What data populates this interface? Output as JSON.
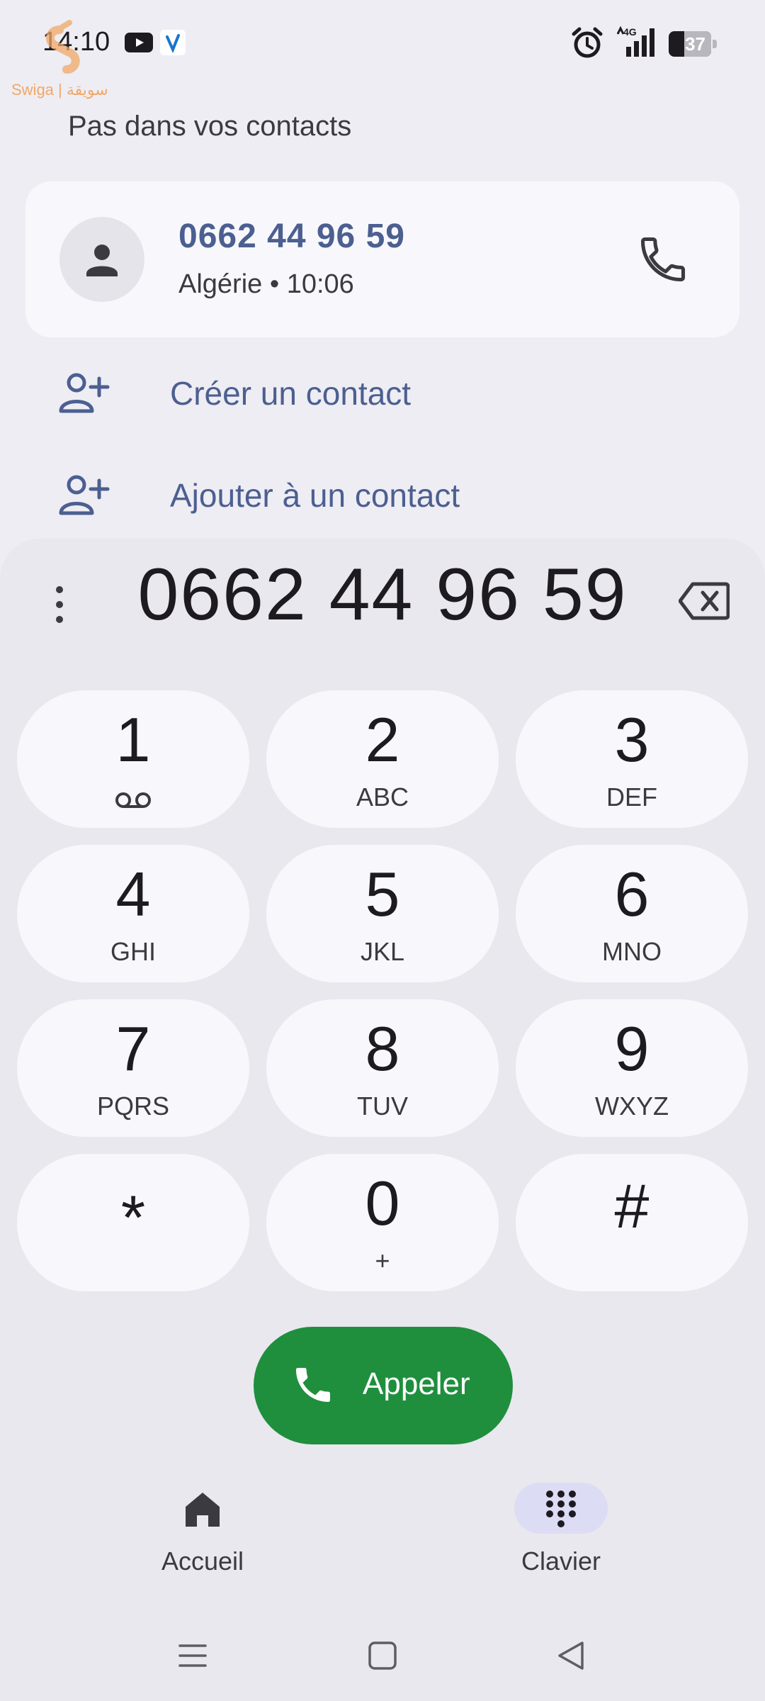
{
  "status_bar": {
    "time": "14:10",
    "network": "4G",
    "battery": "37",
    "battery_fraction": 0.37,
    "icons": [
      "youtube-icon",
      "vpn-icon",
      "alarm-icon",
      "signal-icon",
      "battery-icon"
    ]
  },
  "watermark": {
    "text": "Swiga | سويقة"
  },
  "section_label": "Pas dans vos contacts",
  "contact_card": {
    "number": "0662 44 96 59",
    "meta": "Algérie • 10:06"
  },
  "actions": [
    {
      "label": "Créer un contact",
      "icon": "person-add-icon"
    },
    {
      "label": "Ajouter à un contact",
      "icon": "person-add-icon"
    }
  ],
  "dialer": {
    "number": "0662 44 96 59",
    "keys": [
      {
        "digit": "1",
        "letters": "",
        "voicemail": true
      },
      {
        "digit": "2",
        "letters": "ABC"
      },
      {
        "digit": "3",
        "letters": "DEF"
      },
      {
        "digit": "4",
        "letters": "GHI"
      },
      {
        "digit": "5",
        "letters": "JKL"
      },
      {
        "digit": "6",
        "letters": "MNO"
      },
      {
        "digit": "7",
        "letters": "PQRS"
      },
      {
        "digit": "8",
        "letters": "TUV"
      },
      {
        "digit": "9",
        "letters": "WXYZ"
      },
      {
        "digit": "*",
        "letters": ""
      },
      {
        "digit": "0",
        "letters": "+"
      },
      {
        "digit": "#",
        "letters": ""
      }
    ],
    "call_label": "Appeler"
  },
  "bottom_nav": [
    {
      "label": "Accueil",
      "icon": "home-icon",
      "active": false
    },
    {
      "label": "Clavier",
      "icon": "dialpad-icon",
      "active": true
    }
  ],
  "colors": {
    "accent": "#4c5f91",
    "call_green": "#1f8f3e",
    "background": "#eeedf3",
    "key_background": "#f8f8fc",
    "nav_active": "#dcddf4"
  }
}
